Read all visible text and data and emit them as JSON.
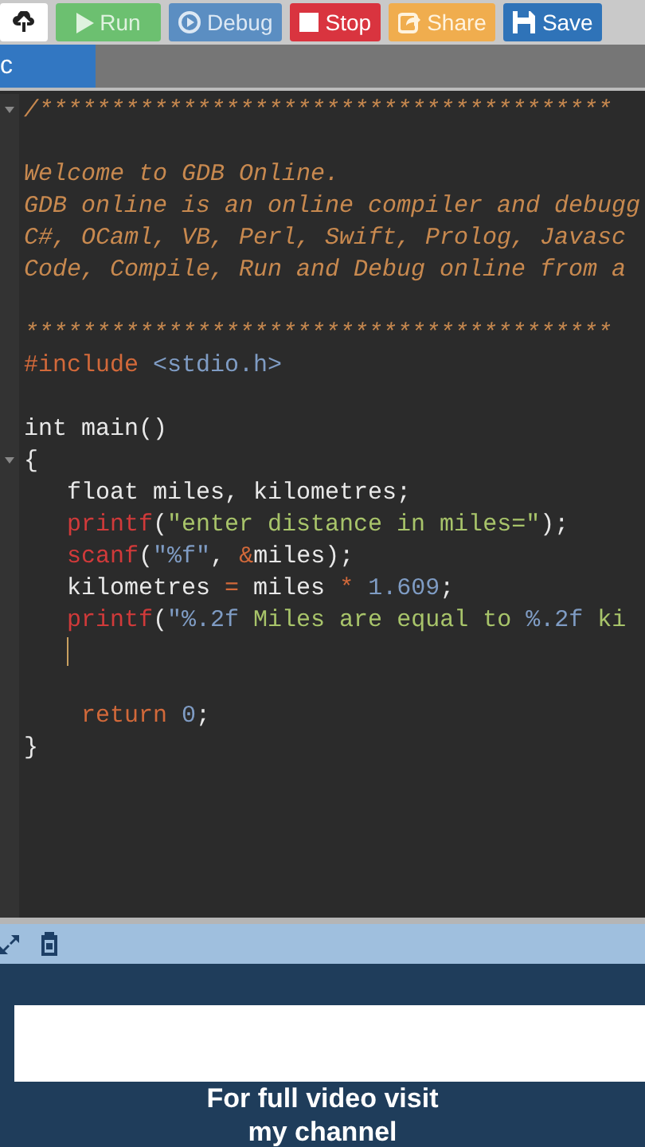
{
  "toolbar": {
    "buttons": [
      {
        "kind": "upload"
      },
      {
        "kind": "run",
        "label": "Run"
      },
      {
        "kind": "debug",
        "label": "Debug"
      },
      {
        "kind": "stop",
        "label": "Stop"
      },
      {
        "kind": "share",
        "label": "Share"
      },
      {
        "kind": "save",
        "label": "Save"
      }
    ]
  },
  "tabs": [
    {
      "label": "c",
      "selected": true
    }
  ],
  "editor": {
    "lines": [
      {
        "kind": "code",
        "fold": true,
        "tokens": [
          {
            "kind": "comment",
            "text": "/****************************************"
          }
        ]
      },
      {
        "kind": "code",
        "fold": false
      },
      {
        "kind": "code",
        "fold": false,
        "tokens": [
          {
            "kind": "comment",
            "text": "Welcome to GDB Online."
          }
        ]
      },
      {
        "kind": "code",
        "fold": false,
        "tokens": [
          {
            "kind": "comment",
            "text": "GDB online is an online compiler and debugg"
          }
        ]
      },
      {
        "kind": "code",
        "fold": false,
        "tokens": [
          {
            "kind": "comment",
            "text": "C#, OCaml, VB, Perl, Swift, Prolog, Javasc"
          }
        ]
      },
      {
        "kind": "code",
        "fold": false,
        "tokens": [
          {
            "kind": "comment",
            "text": "Code, Compile, Run and Debug online from a"
          }
        ]
      },
      {
        "kind": "code",
        "fold": false
      },
      {
        "kind": "code",
        "fold": false,
        "tokens": [
          {
            "kind": "comment",
            "text": "*****************************************"
          }
        ]
      },
      {
        "kind": "code",
        "fold": false,
        "tokens": [
          {
            "kind": "keyword",
            "text": "#include"
          },
          {
            "kind": "header",
            "text": " <stdio.h>"
          }
        ]
      },
      {
        "kind": "code",
        "fold": false
      },
      {
        "kind": "code",
        "fold": false,
        "tokens": [
          {
            "kind": "plain",
            "text": "int main()"
          }
        ]
      },
      {
        "kind": "code",
        "fold": true,
        "tokens": [
          {
            "kind": "plain",
            "text": "{"
          }
        ]
      },
      {
        "kind": "code",
        "fold": false,
        "tokens": [
          {
            "kind": "plain",
            "text": "   float miles, kilometres;"
          }
        ]
      },
      {
        "kind": "code",
        "fold": false,
        "tokens": [
          {
            "kind": "function",
            "text": "   printf"
          },
          {
            "kind": "plain",
            "text": "("
          },
          {
            "kind": "string",
            "text": "\"enter distance in miles=\""
          },
          {
            "kind": "plain",
            "text": ");"
          }
        ]
      },
      {
        "kind": "code",
        "fold": false,
        "tokens": [
          {
            "kind": "function",
            "text": "   scanf"
          },
          {
            "kind": "plain",
            "text": "("
          },
          {
            "kind": "format",
            "text": "\"%f\""
          },
          {
            "kind": "plain",
            "text": ", "
          },
          {
            "kind": "keyword",
            "text": "&"
          },
          {
            "kind": "plain",
            "text": "miles);"
          }
        ]
      },
      {
        "kind": "code",
        "fold": false,
        "tokens": [
          {
            "kind": "plain",
            "text": "   kilometres "
          },
          {
            "kind": "keyword",
            "text": "="
          },
          {
            "kind": "plain",
            "text": " miles "
          },
          {
            "kind": "keyword",
            "text": "*"
          },
          {
            "kind": "number",
            "text": " 1.609"
          },
          {
            "kind": "plain",
            "text": ";"
          }
        ]
      },
      {
        "kind": "code",
        "fold": false,
        "tokens": [
          {
            "kind": "function",
            "text": "   printf"
          },
          {
            "kind": "plain",
            "text": "("
          },
          {
            "kind": "format",
            "text": "\"%.2f"
          },
          {
            "kind": "string",
            "text": " Miles are equal to "
          },
          {
            "kind": "format",
            "text": "%.2f"
          },
          {
            "kind": "string",
            "text": " ki"
          }
        ]
      },
      {
        "kind": "caret",
        "fold": false
      },
      {
        "kind": "code",
        "fold": false
      },
      {
        "kind": "code",
        "fold": false,
        "tokens": [
          {
            "kind": "keyword",
            "text": "    return"
          },
          {
            "kind": "number",
            "text": " 0"
          },
          {
            "kind": "plain",
            "text": ";"
          }
        ]
      },
      {
        "kind": "code",
        "fold": false,
        "tokens": [
          {
            "kind": "plain",
            "text": "}"
          }
        ]
      }
    ]
  },
  "caption": "For full video visit\nmy channel"
}
